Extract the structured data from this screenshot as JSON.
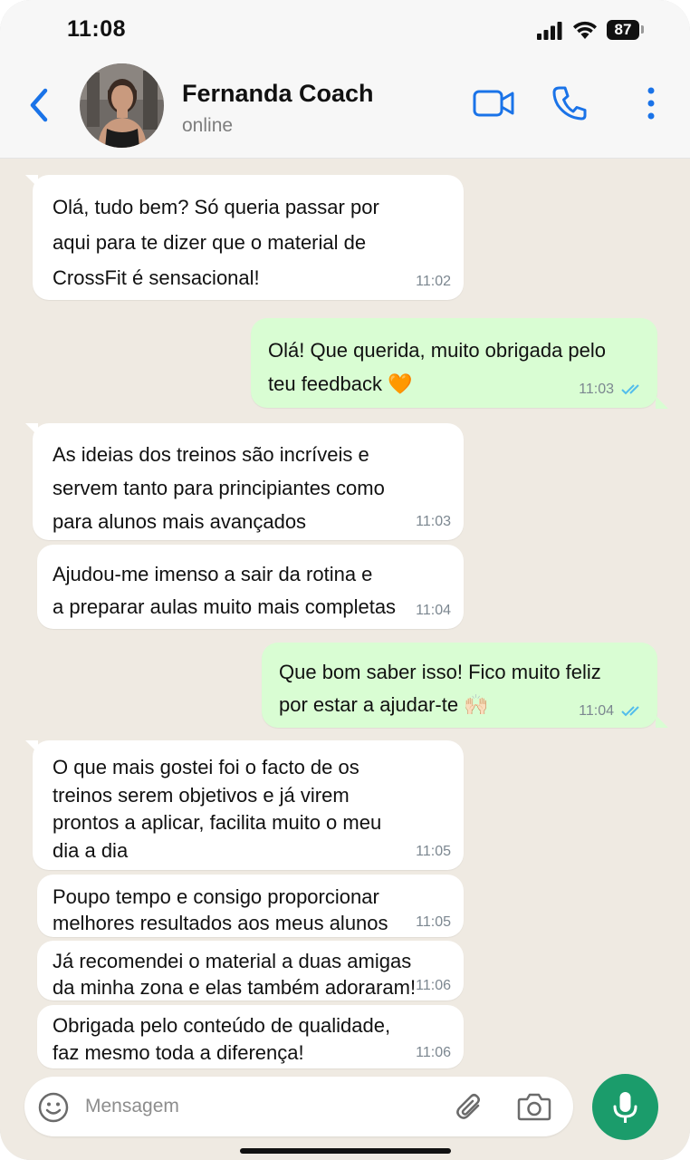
{
  "status_bar": {
    "time": "11:08",
    "battery": "87"
  },
  "header": {
    "contact_name": "Fernanda Coach",
    "contact_status": "online"
  },
  "messages": [
    {
      "from": "in",
      "text": "Olá, tudo bem? Só queria passar por\naqui para te dizer que o material de\nCrossFit é sensacional!",
      "time": "11:02"
    },
    {
      "from": "out",
      "text": "Olá! Que querida, muito obrigada pelo\nteu feedback 🧡",
      "time": "11:03",
      "read": true
    },
    {
      "from": "in",
      "text": "As ideias dos treinos são incríveis e\nservem tanto para principiantes como\npara alunos mais avançados",
      "time": "11:03"
    },
    {
      "from": "in",
      "text": "Ajudou-me imenso a sair da rotina e\na preparar aulas muito mais completas",
      "time": "11:04"
    },
    {
      "from": "out",
      "text": "Que bom saber isso! Fico muito feliz\npor estar a ajudar-te 🙌🏻",
      "time": "11:04",
      "read": true
    },
    {
      "from": "in",
      "text": "O que mais gostei foi o facto de os\ntreinos serem objetivos e já virem\nprontos a aplicar, facilita muito o meu\ndia a dia",
      "time": "11:05"
    },
    {
      "from": "in",
      "text": "Poupo tempo e consigo proporcionar\nmelhores resultados aos meus alunos",
      "time": "11:05"
    },
    {
      "from": "in",
      "text": "Já recomendei o material a duas amigas\nda minha zona e elas também adoraram!",
      "time": "11:06"
    },
    {
      "from": "in",
      "text": "Obrigada pelo conteúdo de qualidade,\nfaz mesmo toda a diferença!",
      "time": "11:06"
    }
  ],
  "composer": {
    "placeholder": "Mensagem"
  },
  "colors": {
    "accent_blue": "#1a73e8",
    "outgoing_bubble": "#d9fdd3",
    "incoming_bubble": "#ffffff",
    "chat_background": "#efeae2",
    "mic_button": "#1b9c6b",
    "read_ticks": "#53bdeb"
  },
  "icons": {
    "back": "chevron-left-icon",
    "video": "video-camera-icon",
    "call": "phone-icon",
    "more": "more-vertical-icon",
    "emoji": "emoji-icon",
    "attach": "paperclip-icon",
    "camera": "camera-icon",
    "mic": "microphone-icon"
  }
}
